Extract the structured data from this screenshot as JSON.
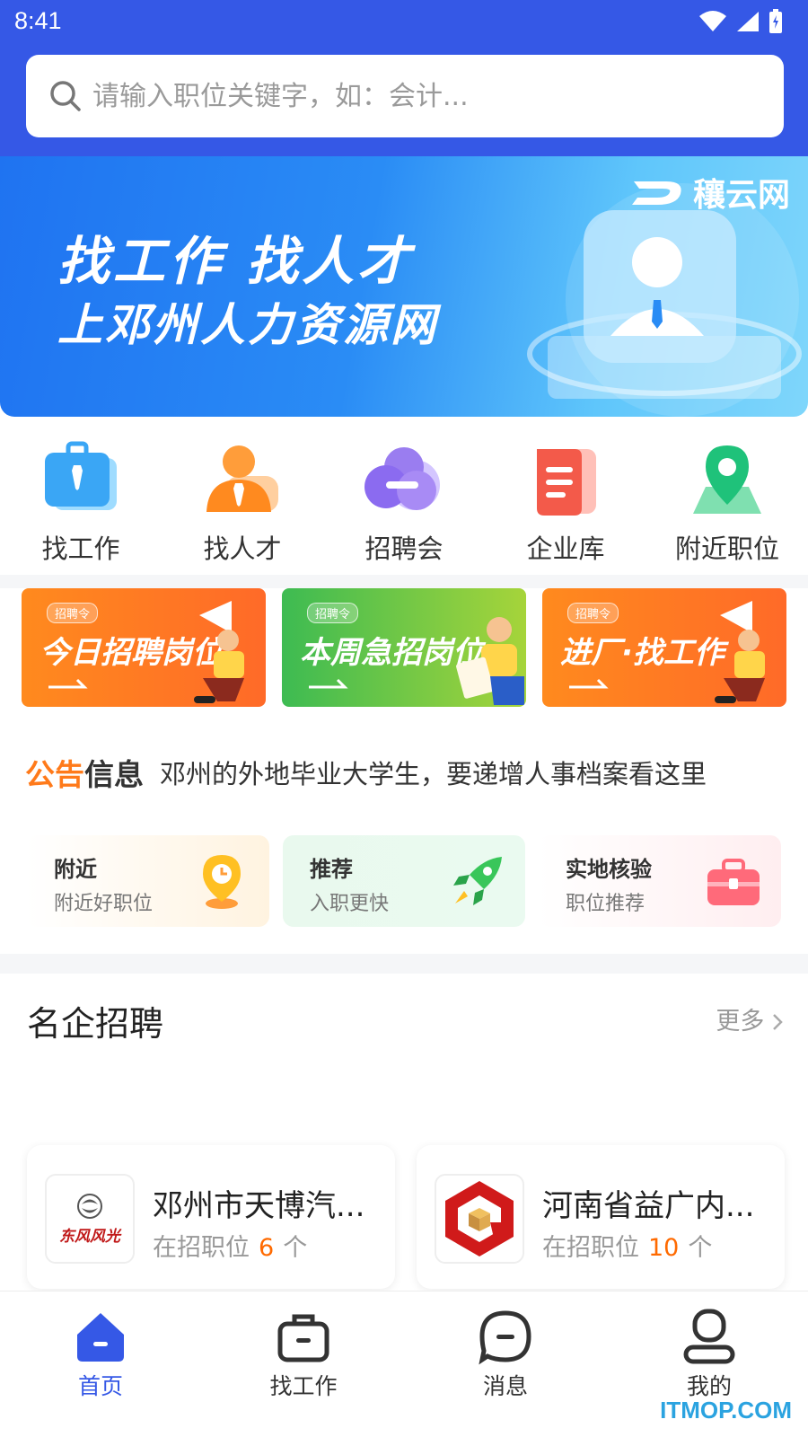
{
  "status": {
    "time": "8:41"
  },
  "search": {
    "placeholder": "请输入职位关键字，如：会计..."
  },
  "banner": {
    "line1": "找工作 找人才",
    "line2": "上邓州人力资源网",
    "brand": "穰云网"
  },
  "quick": [
    {
      "label": "找工作",
      "icon": "briefcase-icon"
    },
    {
      "label": "找人才",
      "icon": "person-icon"
    },
    {
      "label": "招聘会",
      "icon": "meeting-icon"
    },
    {
      "label": "企业库",
      "icon": "document-icon"
    },
    {
      "label": "附近职位",
      "icon": "map-pin-icon"
    }
  ],
  "promos": [
    {
      "tag": "招聘令",
      "title": "今日招聘岗位"
    },
    {
      "tag": "招聘令",
      "title": "本周急招岗位"
    },
    {
      "tag": "招聘令",
      "title": "进厂·找工作"
    }
  ],
  "notice": {
    "label_a": "公告",
    "label_b": "信息",
    "text": "邓州的外地毕业大学生，要递增人事档案看这里"
  },
  "features": [
    {
      "title": "附近",
      "sub": "附近好职位",
      "icon": "clock-pin-icon"
    },
    {
      "title": "推荐",
      "sub": "入职更快",
      "icon": "rocket-icon"
    },
    {
      "title": "实地核验",
      "sub": "职位推荐",
      "icon": "toolbox-icon"
    }
  ],
  "section": {
    "title": "名企招聘",
    "more": "更多"
  },
  "companies": [
    {
      "name": "邓州市天博汽...",
      "count_label": "在招职位",
      "count": "6",
      "unit": "个",
      "logo_text": "东风风光"
    },
    {
      "name": "河南省益广内...",
      "count_label": "在招职位",
      "count": "10",
      "unit": "个"
    }
  ],
  "tabs": [
    {
      "label": "首页",
      "icon": "home-icon"
    },
    {
      "label": "找工作",
      "icon": "briefcase-icon"
    },
    {
      "label": "消息",
      "icon": "message-icon"
    },
    {
      "label": "我的",
      "icon": "user-icon"
    }
  ],
  "watermark": "ITMOP.COM",
  "colors": {
    "primary": "#3558e6",
    "accent": "#ff6a00"
  }
}
